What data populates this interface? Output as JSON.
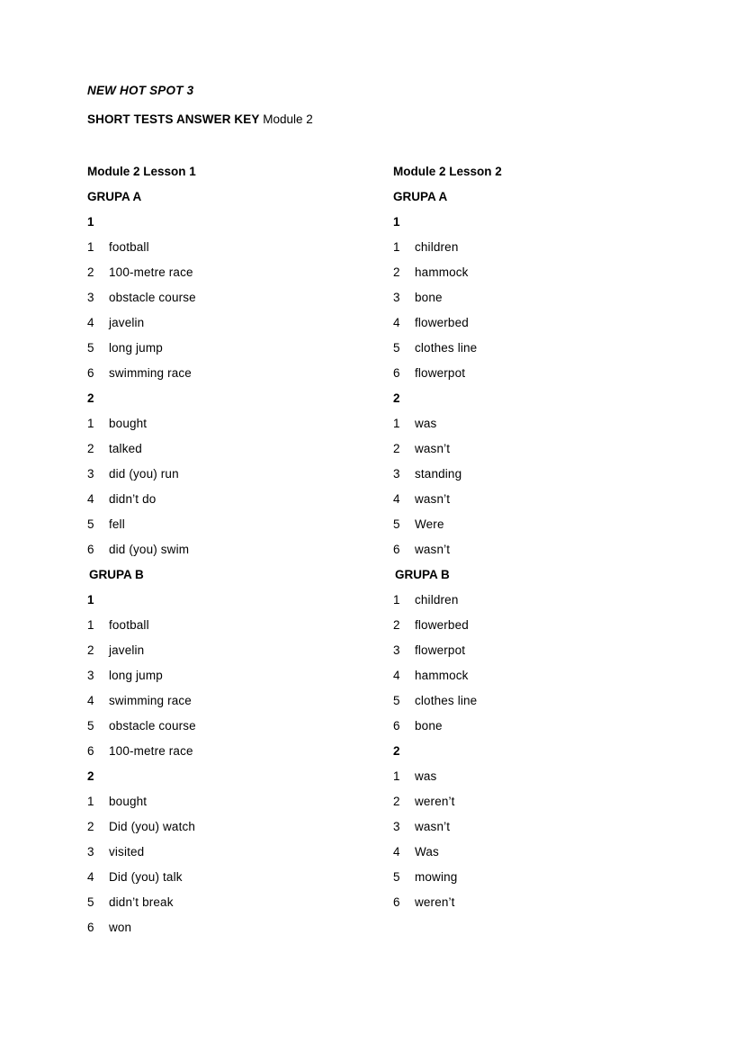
{
  "document": {
    "title": "NEW HOT SPOT 3",
    "subtitle_bold": "SHORT TESTS ANSWER KEY",
    "subtitle_light": " Module 2"
  },
  "columns": [
    {
      "heading": "Module 2 Lesson 1",
      "sections": [
        {
          "group_label": "GRUPA A",
          "exercises": [
            {
              "number": "1",
              "answers": [
                {
                  "num": "1",
                  "text": "football"
                },
                {
                  "num": "2",
                  "text": "100-metre race"
                },
                {
                  "num": "3",
                  "text": "obstacle course"
                },
                {
                  "num": "4",
                  "text": "javelin"
                },
                {
                  "num": "5",
                  "text": "long jump"
                },
                {
                  "num": "6",
                  "text": "swimming race"
                }
              ]
            },
            {
              "number": "2",
              "answers": [
                {
                  "num": "1",
                  "text": "bought"
                },
                {
                  "num": "2",
                  "text": "talked"
                },
                {
                  "num": "3",
                  "text": "did (you) run"
                },
                {
                  "num": "4",
                  "text": "didn’t do"
                },
                {
                  "num": "5",
                  "text": "fell"
                },
                {
                  "num": "6",
                  "text": "did (you) swim"
                }
              ]
            }
          ]
        },
        {
          "group_label": "GRUPA B",
          "exercises": [
            {
              "number": "1",
              "answers": [
                {
                  "num": "1",
                  "text": "football"
                },
                {
                  "num": "2",
                  "text": "javelin"
                },
                {
                  "num": "3",
                  "text": "long jump"
                },
                {
                  "num": "4",
                  "text": "swimming race"
                },
                {
                  "num": "5",
                  "text": "obstacle course"
                },
                {
                  "num": "6",
                  "text": "100-metre race"
                }
              ]
            },
            {
              "number": "2",
              "answers": [
                {
                  "num": "1",
                  "text": "bought"
                },
                {
                  "num": "2",
                  "text": "Did (you) watch"
                },
                {
                  "num": "3",
                  "text": "visited"
                },
                {
                  "num": "4",
                  "text": "Did (you) talk"
                },
                {
                  "num": "5",
                  "text": "didn’t break"
                },
                {
                  "num": "6",
                  "text": "won"
                }
              ]
            }
          ]
        }
      ]
    },
    {
      "heading": "Module 2 Lesson 2",
      "sections": [
        {
          "group_label": "GRUPA A",
          "exercises": [
            {
              "number": "1",
              "answers": [
                {
                  "num": "1",
                  "text": "children"
                },
                {
                  "num": "2",
                  "text": "hammock"
                },
                {
                  "num": "3",
                  "text": "bone"
                },
                {
                  "num": "4",
                  "text": "flowerbed"
                },
                {
                  "num": "5",
                  "text": "clothes line"
                },
                {
                  "num": "6",
                  "text": "flowerpot"
                }
              ]
            },
            {
              "number": "2",
              "answers": [
                {
                  "num": "1",
                  "text": "was"
                },
                {
                  "num": "2",
                  "text": "wasn’t"
                },
                {
                  "num": "3",
                  "text": "standing"
                },
                {
                  "num": "4",
                  "text": "wasn’t"
                },
                {
                  "num": "5",
                  "text": "Were"
                },
                {
                  "num": "6",
                  "text": "wasn’t"
                }
              ]
            }
          ]
        },
        {
          "group_label": "GRUPA B",
          "exercises": [
            {
              "number": null,
              "answers": [
                {
                  "num": "1",
                  "text": "children"
                },
                {
                  "num": "2",
                  "text": "flowerbed"
                },
                {
                  "num": "3",
                  "text": "flowerpot"
                },
                {
                  "num": "4",
                  "text": "hammock"
                },
                {
                  "num": "5",
                  "text": "clothes line"
                },
                {
                  "num": "6",
                  "text": "bone"
                }
              ]
            },
            {
              "number": "2",
              "answers": [
                {
                  "num": "1",
                  "text": "was"
                },
                {
                  "num": "2",
                  "text": "weren’t"
                },
                {
                  "num": "3",
                  "text": "wasn’t"
                },
                {
                  "num": "4",
                  "text": "Was"
                },
                {
                  "num": "5",
                  "text": "mowing"
                },
                {
                  "num": "6",
                  "text": "weren’t"
                }
              ]
            }
          ]
        }
      ]
    }
  ]
}
